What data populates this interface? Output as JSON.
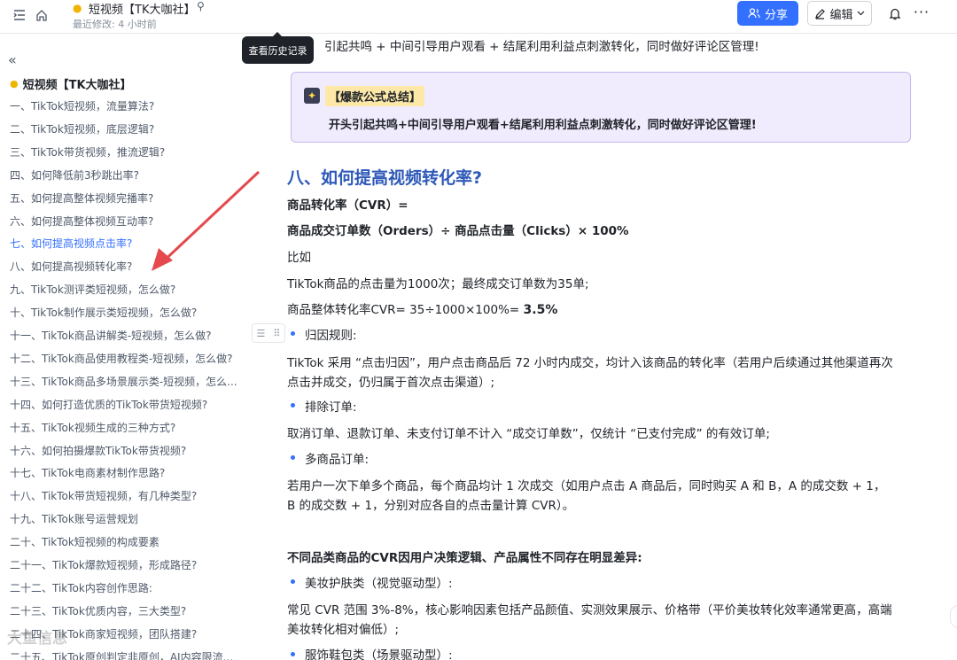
{
  "header": {
    "doc_emoji": "🪙",
    "title": "短视频【TK大咖社】",
    "meta": "最近修改: 4 小时前",
    "share_label": "分享",
    "edit_label": "编辑",
    "tooltip": "查看历史记录"
  },
  "toc": {
    "title": "短视频【TK大咖社】",
    "items": [
      "一、TikTok短视频，流量算法?",
      "二、TikTok短视频，底层逻辑?",
      "三、TikTok带货视频，推流逻辑?",
      "四、如何降低前3秒跳出率?",
      "五、如何提高整体视频完播率?",
      "六、如何提高整体视频互动率?",
      "七、如何提高视频点击率?",
      "八、如何提高视频转化率?",
      "九、TikTok测评类短视频，怎么做?",
      "十、TikTok制作展示类短视频，怎么做?",
      "十一、TikTok商品讲解类-短视频，怎么做?",
      "十二、TikTok商品使用教程类-短视频，怎么做?",
      "十三、TikTok商品多场景展示类-短视频，怎么...",
      "十四、如何打造优质的TikTok带货短视频?",
      "十五、TikTok视频生成的三种方式?",
      "十六、如何拍摄爆款TikTok带货视频?",
      "十七、TikTok电商素材制作思路?",
      "十八、TikTok带货短视频，有几种类型?",
      "十九、TikTok账号运营规划",
      "二十、TikTok短视频的构成要素",
      "二十一、TikTok爆款短视频，形成路径?",
      "二十二、TikTok内容创作思路:",
      "二十三、TikTok优质内容，三大类型?",
      "二十四、TikTok商家短视频，团队搭建?",
      "二十五、TikTok原创判定非原创，AI内容限流..."
    ],
    "active_index": 6
  },
  "content": {
    "top_line": "引起共鸣 + 中间引导用户观看 + 结尾利用利益点刺激转化，同时做好评论区管理!",
    "callout_title": "【爆款公式总结】",
    "callout_body": "开头引起共鸣+中间引导用户观看+结尾利用利益点刺激转化，同时做好评论区管理!",
    "heading": "八、如何提高视频转化率?",
    "lines": [
      "商品转化率（CVR）=",
      "商品成交订单数（Orders）÷ 商品点击量（Clicks）× 100%",
      "比如",
      "TikTok商品的点击量为1000次；最终成交订单数为35单;",
      "商品整体转化率CVR= 35÷1000×100%=",
      "3.5%",
      "归因规则:",
      "TikTok 采用 “点击归因”，用户点击商品后 72 小时内成交，均计入该商品的转化率（若用户后续通过其他渠道再次",
      "点击并成交，仍归属于首次点击渠道）;",
      "排除订单:",
      "取消订单、退款订单、未支付订单不计入 “成交订单数”，仅统计 “已支付完成” 的有效订单;",
      "多商品订单:",
      "若用户一次下单多个商品，每个商品均计 1 次成交（如用户点击 A 商品后，同时购买 A 和 B，A 的成交数 + 1，",
      "B 的成交数 + 1，分别对应各自的点击量计算 CVR）。",
      "不同品类商品的CVR因用户决策逻辑、产品属性不同存在明显差异:",
      "美妆护肤类（视觉驱动型）:",
      "常见 CVR 范围 3%-8%，核心影响因素包括产品颜值、实测效果展示、价格带（平价美妆转化效率通常更高，高端",
      "美妆转化相对偏低）;",
      "服饰鞋包类（场景驱动型）:"
    ]
  },
  "watermark": "大鱼信息",
  "colors": {
    "accent": "#3370ff",
    "heading": "#2e59b8",
    "callout_bg": "#f1ecfd",
    "arrow": "#e5484d"
  }
}
